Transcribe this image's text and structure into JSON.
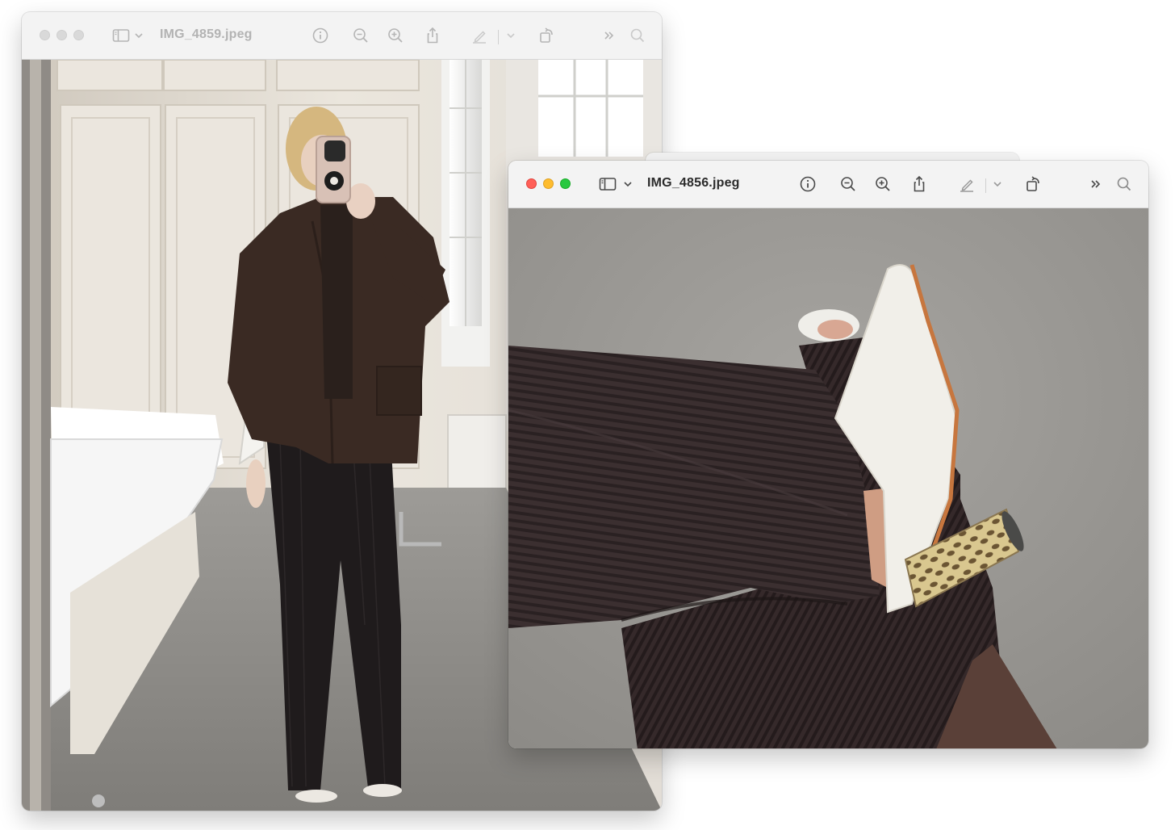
{
  "windows": [
    {
      "id": "back",
      "title": "IMG_4859.jpeg",
      "state": "inactive",
      "photo": "mirror-selfie-full-outfit"
    },
    {
      "id": "front",
      "title": "IMG_4856.jpeg",
      "state": "active",
      "photo": "close-up-corduroy-trousers-and-mule-heel"
    }
  ],
  "toolbar_icons": [
    "sidebar-icon",
    "chevron-down-icon",
    "info-icon",
    "zoom-out-icon",
    "zoom-in-icon",
    "share-icon",
    "markup-pen-icon",
    "chevron-down-icon",
    "rotate-icon",
    "more-icon",
    "search-icon"
  ],
  "colors": {
    "titlebar": "#f3f3f3",
    "inactive_icon": "#b5b5b5",
    "active_icon": "#4a4a4a",
    "close": "#ff5f57",
    "minimize": "#febc2e",
    "zoom": "#28c840"
  }
}
